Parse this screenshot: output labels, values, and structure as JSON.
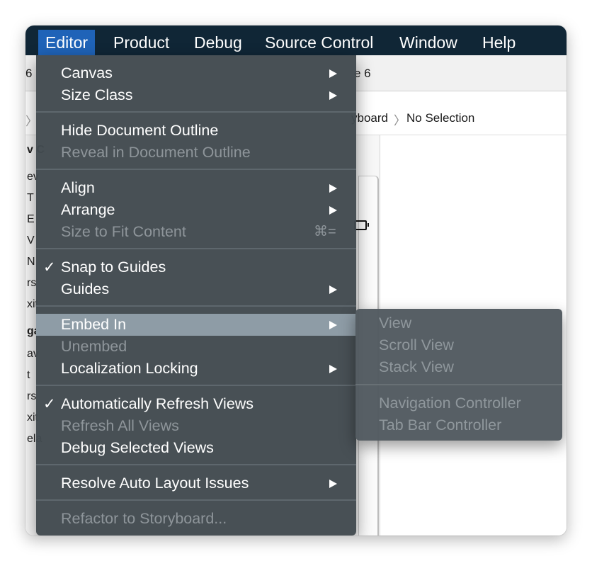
{
  "menubar": {
    "items": [
      {
        "label": "Editor",
        "active": true
      },
      {
        "label": "Product"
      },
      {
        "label": "Debug"
      },
      {
        "label": "Source Control"
      },
      {
        "label": "Window"
      },
      {
        "label": "Help"
      }
    ]
  },
  "background": {
    "toolbar_left_fragment": "6",
    "toolbar_right_fragment": "e 6",
    "breadcrumb_fragment": "yboard",
    "breadcrumb_separator": "〉",
    "breadcrumb_selection": "No Selection",
    "breadcrumb_left_chevron": "〉",
    "left_fragments": [
      "v C",
      "ev",
      "T",
      "E",
      "V",
      "N",
      "rs",
      "xit",
      "ga",
      "av",
      "t",
      "rs",
      "xit",
      "ela"
    ]
  },
  "editor_menu": {
    "items": [
      {
        "label": "Canvas",
        "submenu": true
      },
      {
        "label": "Size Class",
        "submenu": true
      },
      {
        "label": "Hide Document Outline"
      },
      {
        "label": "Reveal in Document Outline",
        "disabled": true
      },
      {
        "label": "Align",
        "submenu": true
      },
      {
        "label": "Arrange",
        "submenu": true
      },
      {
        "label": "Size to Fit Content",
        "disabled": true,
        "shortcut": "⌘="
      },
      {
        "label": "Snap to Guides",
        "checked": true,
        "check_mark": "✓"
      },
      {
        "label": "Guides",
        "submenu": true
      },
      {
        "label": "Embed In",
        "submenu": true,
        "highlighted": true
      },
      {
        "label": "Unembed",
        "disabled": true
      },
      {
        "label": "Localization Locking",
        "submenu": true
      },
      {
        "label": "Automatically Refresh Views",
        "checked": true,
        "check_mark": "✓"
      },
      {
        "label": "Refresh All Views",
        "disabled": true
      },
      {
        "label": "Debug Selected Views"
      },
      {
        "label": "Resolve Auto Layout Issues",
        "submenu": true
      },
      {
        "label": "Refactor to Storyboard...",
        "disabled": true
      }
    ]
  },
  "embed_submenu": {
    "items": [
      {
        "label": "View",
        "disabled": true
      },
      {
        "label": "Scroll View",
        "disabled": true
      },
      {
        "label": "Stack View",
        "disabled": true
      },
      {
        "label": "Navigation Controller",
        "disabled": true
      },
      {
        "label": "Tab Bar Controller",
        "disabled": true
      }
    ]
  },
  "colors": {
    "menubar_bg": "#102636",
    "menubar_active": "#1f63b8",
    "menu_bg": "#424a4f",
    "menu_highlight": "#8e9ca6",
    "disabled_text": "#8e959a"
  }
}
